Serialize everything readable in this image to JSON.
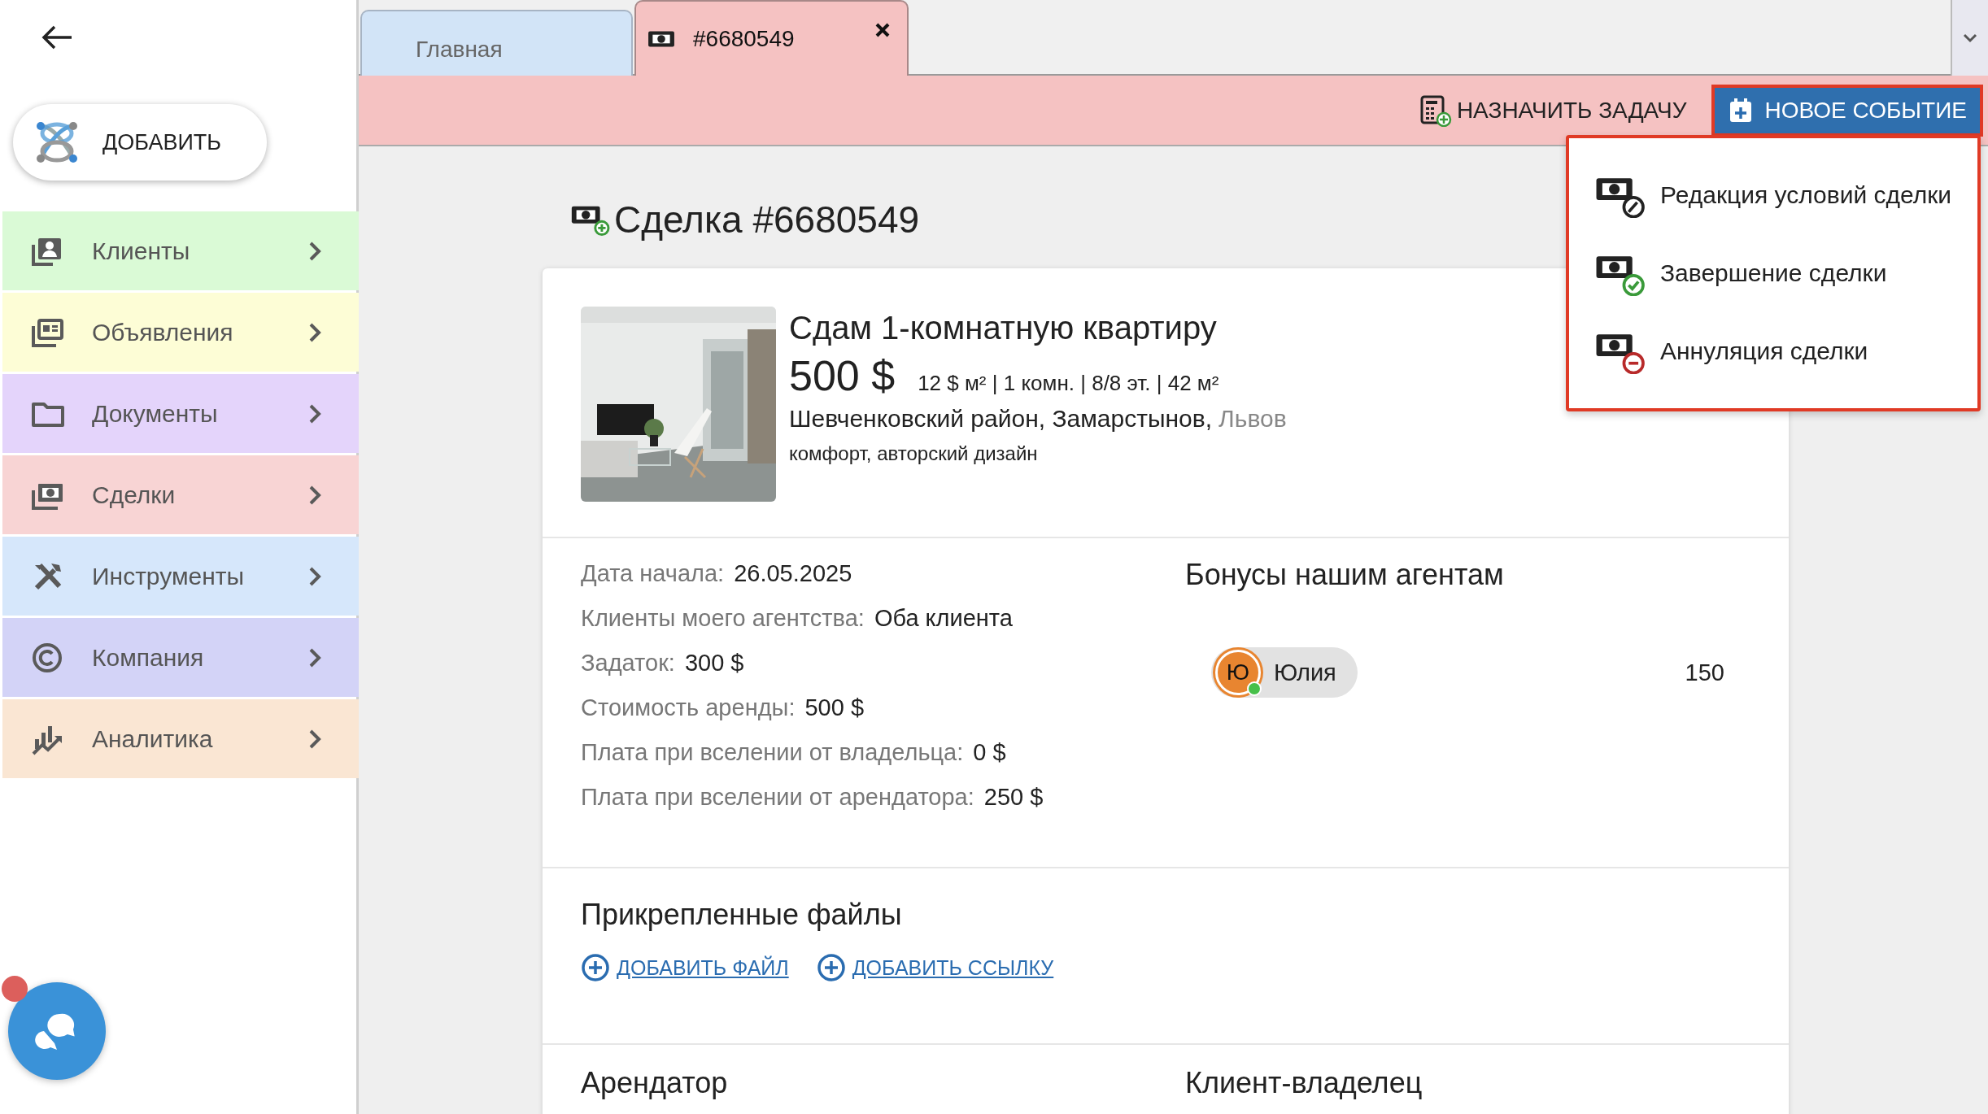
{
  "sidebar": {
    "add_button": "ДОБАВИТЬ",
    "items": [
      {
        "label": "Клиенты",
        "color": "#dafad6"
      },
      {
        "label": "Объявления",
        "color": "#fdfdd6"
      },
      {
        "label": "Документы",
        "color": "#e4d4fb"
      },
      {
        "label": "Сделки",
        "color": "#f8d4d4"
      },
      {
        "label": "Инструменты",
        "color": "#d6e7fb"
      },
      {
        "label": "Компания",
        "color": "#d3d3f7"
      },
      {
        "label": "Аналитика",
        "color": "#fae6d3"
      }
    ],
    "chat": {
      "unread": true
    }
  },
  "tabs": [
    {
      "label": "Главная",
      "selected": false,
      "closable": false
    },
    {
      "label": "#6680549",
      "selected": true,
      "closable": true
    }
  ],
  "toolbar": {
    "buttons": [
      {
        "label": "НАЗНАЧИТЬ ЗАДАЧУ",
        "kind": "plain",
        "expanded": false
      },
      {
        "label": "НОВОЕ СОБЫТИЕ",
        "kind": "primary",
        "expanded": true
      }
    ],
    "menu": [
      {
        "label": "Редакция условий сделки"
      },
      {
        "label": "Завершение сделки"
      },
      {
        "label": "Аннуляция сделки"
      }
    ]
  },
  "deal": {
    "title": "Сделка #6680549",
    "listing": {
      "title": "Сдам 1-комнатную квартиру",
      "price": "500 $",
      "details": "12 $ м² | 1 комн. | 8/8 эт. | 42 м²",
      "address": "Шевченковский район, Замарстынов,",
      "city": "Львов",
      "tags": "комфорт, авторский дизайн"
    },
    "fields": [
      {
        "label": "Дата начала:",
        "value": "26.05.2025"
      },
      {
        "label": "Клиенты моего агентства:",
        "value": "Оба клиента"
      },
      {
        "label": "Задаток:",
        "value": "300 $"
      },
      {
        "label": "Стоимость аренды:",
        "value": "500 $"
      },
      {
        "label": "Плата при вселении от владельца:",
        "value": "0 $"
      },
      {
        "label": "Плата при вселении от арендатора:",
        "value": "250 $"
      }
    ],
    "bonuses": {
      "title": "Бонусы нашим агентам",
      "agents": [
        {
          "initial": "Ю",
          "name": "Юлия",
          "online": true,
          "amount": "150"
        }
      ]
    },
    "files": {
      "title": "Прикрепленные файлы",
      "links": [
        "ДОБАВИТЬ ФАЙЛ",
        "ДОБАВИТЬ ССЫЛКУ"
      ]
    },
    "parties": [
      "Арендатор",
      "Клиент-владелец"
    ]
  }
}
